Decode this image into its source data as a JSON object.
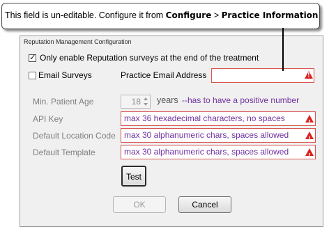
{
  "callout": {
    "prefix": "This field is un-editable. Configure it  from",
    "menu": "Configure",
    "separator": ">",
    "item": "Practice Information"
  },
  "dialog": {
    "title": "Reputation Management Configuration",
    "only_end_treatment_label": "Only enable Reputation surveys at the end of the treatment",
    "only_end_treatment_checked": true,
    "email_surveys_label": "Email Surveys",
    "email_surveys_checked": false,
    "practice_email_label": "Practice Email Address",
    "practice_email_value": "",
    "min_age_label": "Min. Patient Age",
    "min_age_value": "18",
    "min_age_unit": "years",
    "min_age_hint": "--has to have a positive number",
    "api_key_label": "API Key",
    "api_key_value": "max 36 hexadecimal characters, no spaces",
    "location_code_label": "Default Location Code",
    "location_code_value": "max 30 alphanumeric chars, spaces allowed",
    "template_label": "Default Template",
    "template_value": "max 30 alphanumeric chars, spaces allowed",
    "test_button": "Test",
    "ok_button": "OK",
    "cancel_button": "Cancel"
  },
  "colors": {
    "error_border": "#d9534f",
    "hint_text": "#7030a0",
    "warning_icon": "#d9241e"
  }
}
